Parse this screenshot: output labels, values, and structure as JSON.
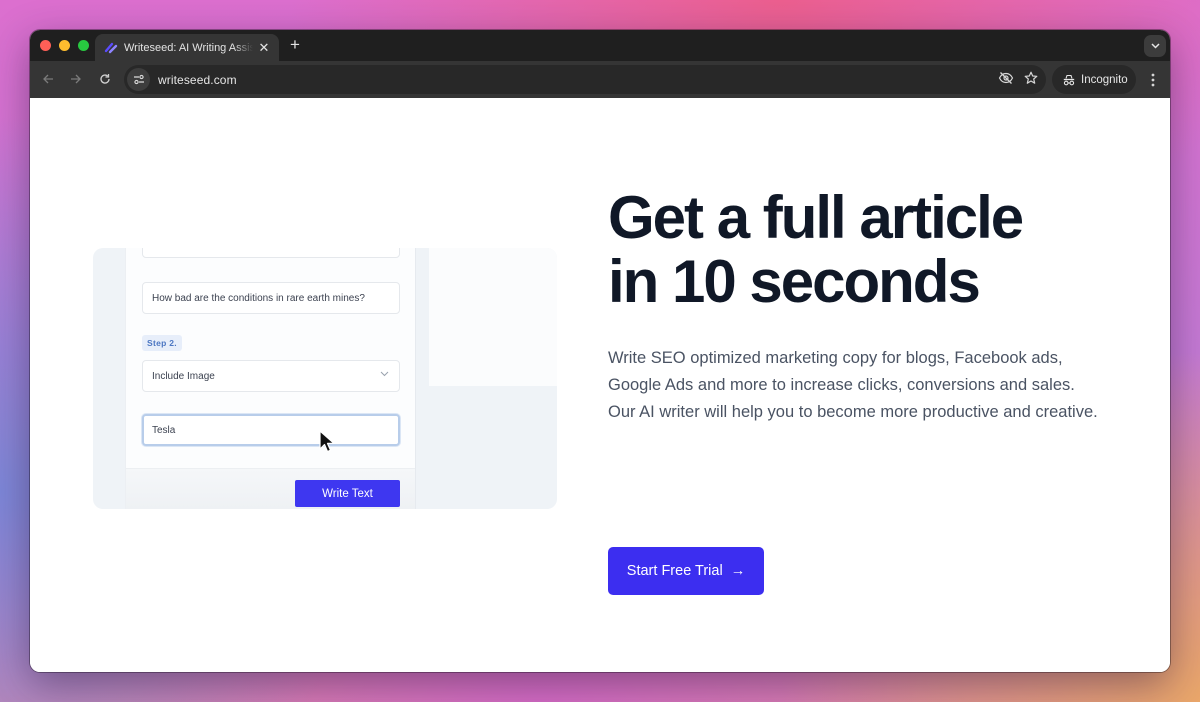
{
  "browser": {
    "tab": {
      "title": "Writeseed: AI Writing Assistant",
      "favicon": "writeseed-logo-icon",
      "close_glyph": "✕"
    },
    "new_tab_glyph": "+",
    "address": "writeseed.com",
    "incognito_label": "Incognito",
    "icons": [
      "back-arrow-icon",
      "forward-arrow-icon",
      "reload-icon",
      "site-info-icon",
      "eye-slash-icon",
      "star-icon",
      "incognito-icon",
      "kebab-menu-icon",
      "tab-search-chevron-icon"
    ]
  },
  "demo": {
    "top_field_value": "",
    "question_value": "How bad are the conditions in rare earth mines?",
    "step_label": "Step 2.",
    "select_value": "Include Image",
    "keyword_value": "Tesla",
    "write_button": "Write Text"
  },
  "hero": {
    "headline_line1": "Get a full article",
    "headline_line2": "in 10 seconds",
    "description": "Write SEO optimized marketing copy for blogs, Facebook ads, Google Ads and more to increase clicks, conversions and sales. Our AI writer will help you to become more productive and creative.",
    "cta_label": "Start Free Trial",
    "cta_arrow": "→"
  },
  "colors": {
    "brand": "#3c2ef0",
    "headline": "#101827",
    "body_text": "#4a5363"
  }
}
